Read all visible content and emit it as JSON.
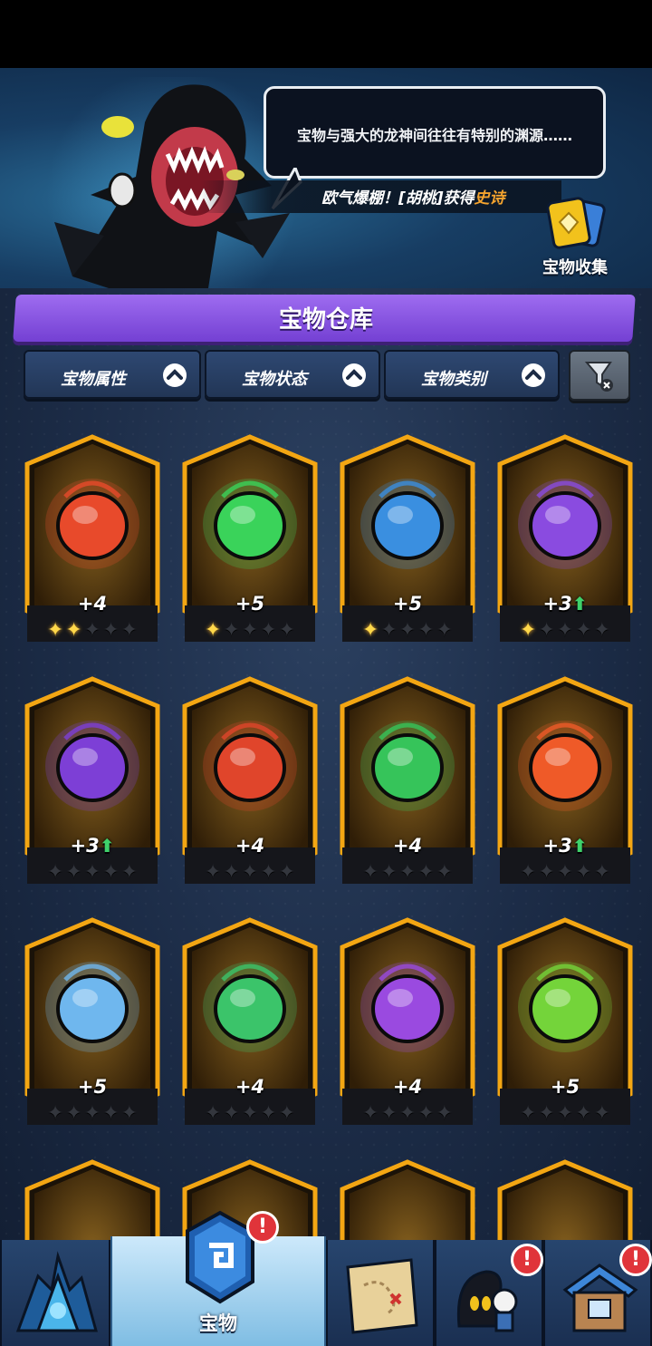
{
  "banner": {
    "speech_text": "宝物与强大的龙神间往往有特别的渊源……",
    "ticker_prefix": "欧气爆棚！[胡桃]获得",
    "ticker_epic": "史诗",
    "collect_label": "宝物收集"
  },
  "warehouse": {
    "title": "宝物仓库",
    "filters": [
      {
        "label": "宝物属性"
      },
      {
        "label": "宝物状态"
      },
      {
        "label": "宝物类别"
      }
    ]
  },
  "treasures": [
    {
      "level": "+4",
      "upgrade": false,
      "lit_stars": 2,
      "icon": "flaming-collar-icon",
      "color": "#e84a2b"
    },
    {
      "level": "+5",
      "upgrade": false,
      "lit_stars": 1,
      "icon": "green-orb-icon",
      "color": "#3ad35a"
    },
    {
      "level": "+5",
      "upgrade": false,
      "lit_stars": 1,
      "icon": "plaque-icon",
      "color": "#3a8fe0"
    },
    {
      "level": "+3",
      "upgrade": true,
      "lit_stars": 1,
      "icon": "cursed-book-icon",
      "color": "#8a4be0"
    },
    {
      "level": "+3",
      "upgrade": true,
      "lit_stars": 0,
      "icon": "rune-coin-icon",
      "color": "#7d3fd6"
    },
    {
      "level": "+4",
      "upgrade": false,
      "lit_stars": 0,
      "icon": "fire-seal-icon",
      "color": "#e0452b"
    },
    {
      "level": "+4",
      "upgrade": false,
      "lit_stars": 0,
      "icon": "green-wing-icon",
      "color": "#36c45a"
    },
    {
      "level": "+3",
      "upgrade": true,
      "lit_stars": 0,
      "icon": "flame-claw-icon",
      "color": "#ef5a28"
    },
    {
      "level": "+5",
      "upgrade": false,
      "lit_stars": 0,
      "icon": "ice-dragon-icon",
      "color": "#6fb7ee"
    },
    {
      "level": "+4",
      "upgrade": false,
      "lit_stars": 0,
      "icon": "jade-jar-icon",
      "color": "#3bc46a"
    },
    {
      "level": "+4",
      "upgrade": false,
      "lit_stars": 0,
      "icon": "purple-horn-icon",
      "color": "#9a4ae0"
    },
    {
      "level": "+5",
      "upgrade": false,
      "lit_stars": 0,
      "icon": "leaf-crown-icon",
      "color": "#74d43a"
    }
  ],
  "bottom_nav": {
    "items": [
      {
        "label": "",
        "icon": "crystal-peak-icon",
        "badge": ""
      },
      {
        "label": "宝物",
        "icon": "treasure-rune-icon",
        "badge": "!"
      },
      {
        "label": "",
        "icon": "treasure-map-icon",
        "badge": ""
      },
      {
        "label": "",
        "icon": "heroes-icon",
        "badge": "!"
      },
      {
        "label": "",
        "icon": "shop-house-icon",
        "badge": "!"
      }
    ]
  }
}
